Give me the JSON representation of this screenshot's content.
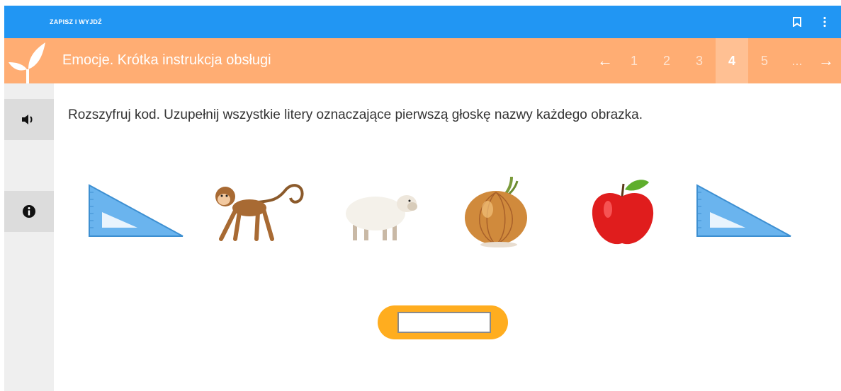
{
  "topbar": {
    "save_label": "ZAPISZ I WYJDŹ",
    "bookmark_icon": "bookmark-icon",
    "menu_icon": "more-vert-icon"
  },
  "lesson": {
    "title": "Emocje. Krótka instrukcja obsługi",
    "icon": "leaf-icon"
  },
  "pager": {
    "prev": "←",
    "pages": [
      "1",
      "2",
      "3",
      "4",
      "5",
      "..."
    ],
    "current": "4",
    "next": "→"
  },
  "sidebar": {
    "audio_icon": "speaker-icon",
    "info_icon": "info-icon"
  },
  "task": {
    "instruction": "Rozszyfruj kod. Uzupełnij wszystkie litery oznaczające pierwszą głoskę nazwy każdego obrazka.",
    "pictures": [
      "set-square",
      "monkey",
      "sheep",
      "onion",
      "apple",
      "set-square"
    ],
    "answer_value": ""
  },
  "colors": {
    "topbar": "#2196f3",
    "titlebar": "#ffad73",
    "answer_pill": "#ffad1f"
  }
}
